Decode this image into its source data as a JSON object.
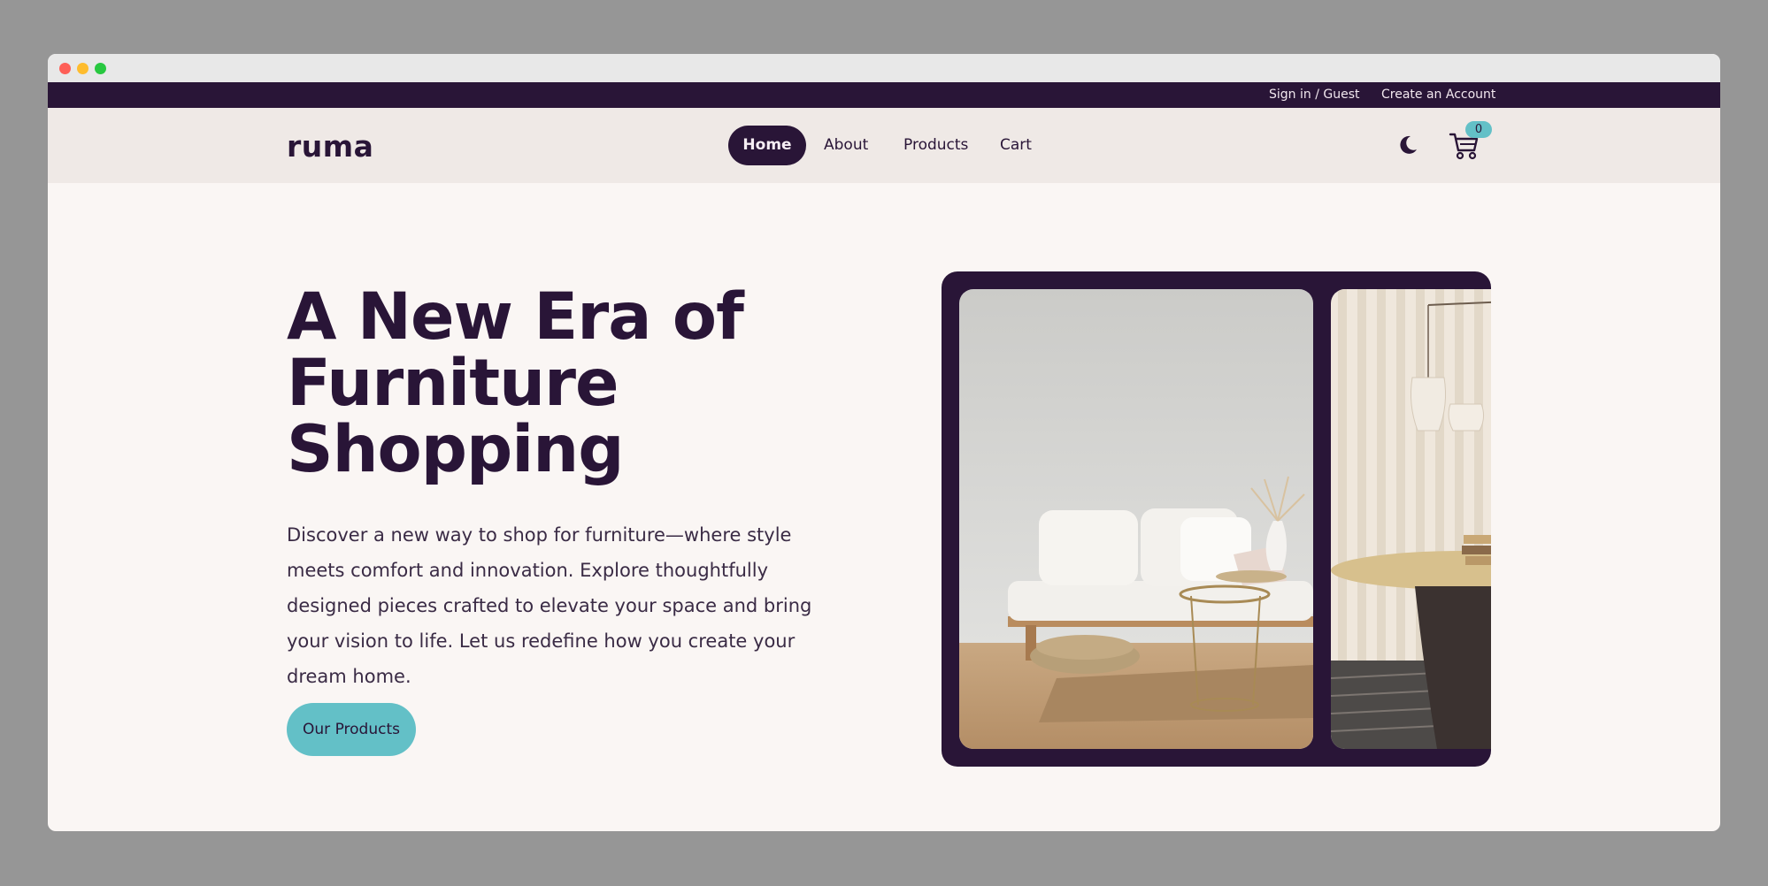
{
  "topbar": {
    "sign_in_label": "Sign in / Guest",
    "create_account_label": "Create an Account"
  },
  "nav": {
    "logo": "ruma",
    "links": [
      "Home",
      "About",
      "Products",
      "Cart"
    ],
    "active": "Home",
    "cart_count": "0",
    "theme_icon": "moon-icon",
    "cart_icon": "cart-icon"
  },
  "hero": {
    "title": "A New Era of Furniture Shopping",
    "description": "Discover a new way to shop for furniture—where style meets comfort and innovation. Explore thoughtfully designed pieces crafted to elevate your space and bring your vision to life. Let us redefine how you create your dream home.",
    "cta_label": "Our Products"
  },
  "colors": {
    "primary": "#291537",
    "accent": "#63c0c7",
    "background": "#faf6f4",
    "navbar": "#efe9e6"
  }
}
